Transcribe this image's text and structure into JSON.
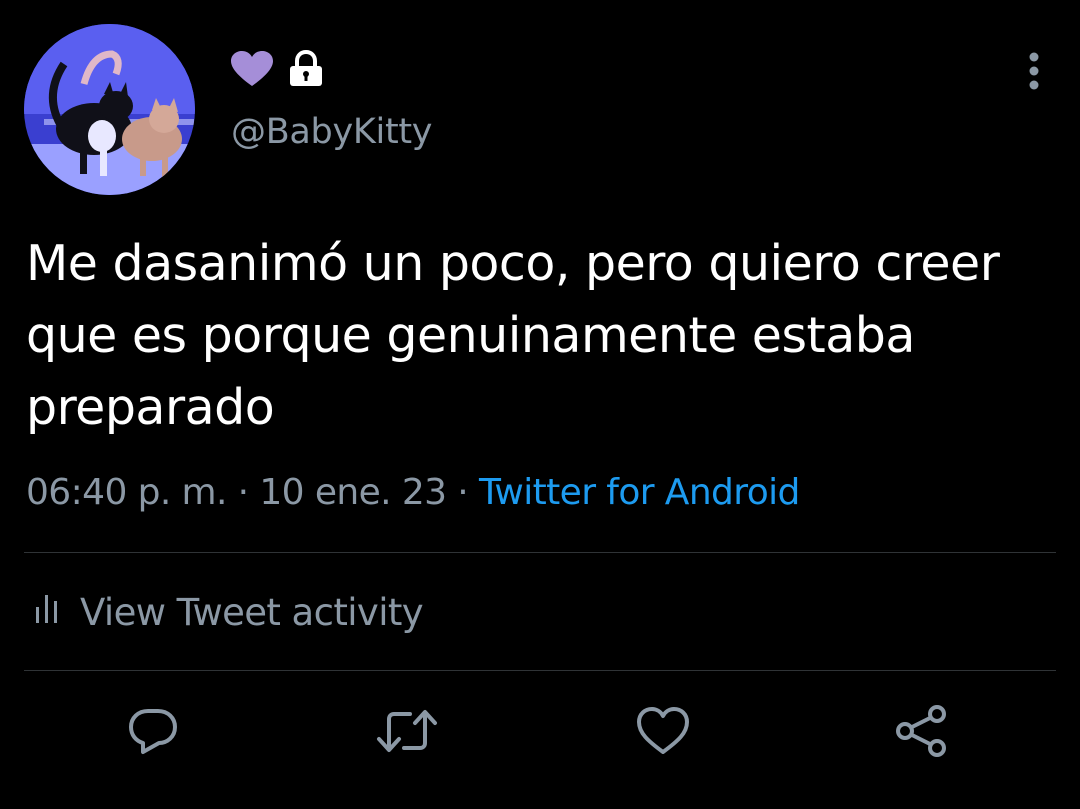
{
  "profile": {
    "handle": "@BabyKitty",
    "name_icons": [
      "heart-icon",
      "lock-icon"
    ],
    "accent_purple": "#a58ed8"
  },
  "tweet": {
    "text": "Me dasanimó un poco, pero quiero creer que es porque genuinamente estaba preparado",
    "time": "06:40 p. m.",
    "separator": " · ",
    "date": "10 ene. 23",
    "source": "Twitter for Android"
  },
  "activity": {
    "label": "View Tweet activity",
    "icon": "bar-chart-icon"
  },
  "actions": [
    {
      "icon": "reply-icon"
    },
    {
      "icon": "retweet-icon"
    },
    {
      "icon": "like-icon"
    },
    {
      "icon": "share-icon"
    }
  ],
  "colors": {
    "background": "#000000",
    "text": "#ffffff",
    "muted": "#8b98a5",
    "link": "#1d9bf0",
    "divider": "#2f3336"
  }
}
